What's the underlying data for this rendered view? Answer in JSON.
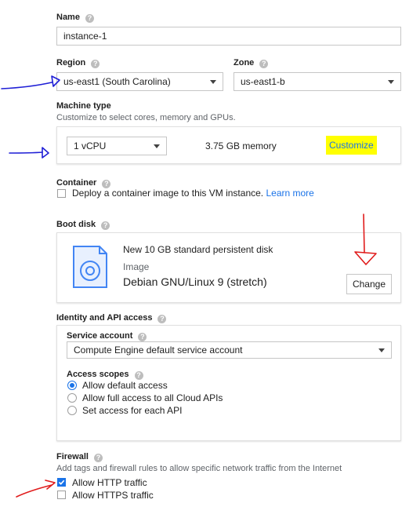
{
  "name": {
    "label": "Name",
    "value": "instance-1"
  },
  "region": {
    "label": "Region",
    "value": "us-east1 (South Carolina)"
  },
  "zone": {
    "label": "Zone",
    "value": "us-east1-b"
  },
  "machine_type": {
    "label": "Machine type",
    "subtitle": "Customize to select cores, memory and GPUs.",
    "cpu_value": "1 vCPU",
    "memory": "3.75 GB memory",
    "customize_label": "Customize"
  },
  "container": {
    "label": "Container",
    "checkbox_label": "Deploy a container image to this VM instance.",
    "learn_more": "Learn more"
  },
  "boot_disk": {
    "label": "Boot disk",
    "disk_title": "New 10 GB standard persistent disk",
    "image_label": "Image",
    "image_value": "Debian GNU/Linux 9 (stretch)",
    "change_label": "Change"
  },
  "identity": {
    "label": "Identity and API access",
    "service_account_label": "Service account",
    "service_account_value": "Compute Engine default service account",
    "access_scopes_label": "Access scopes",
    "scopes": [
      {
        "label": "Allow default access",
        "selected": true
      },
      {
        "label": "Allow full access to all Cloud APIs",
        "selected": false
      },
      {
        "label": "Set access for each API",
        "selected": false
      }
    ]
  },
  "firewall": {
    "label": "Firewall",
    "subtitle": "Add tags and firewall rules to allow specific network traffic from the Internet",
    "http_label": "Allow HTTP traffic",
    "http_checked": true,
    "https_label": "Allow HTTPS traffic",
    "https_checked": false
  },
  "colors": {
    "accent": "#1a73e8",
    "highlight": "#ffff00",
    "annotation_blue": "#1f1fd6",
    "annotation_red": "#e01b1b"
  }
}
